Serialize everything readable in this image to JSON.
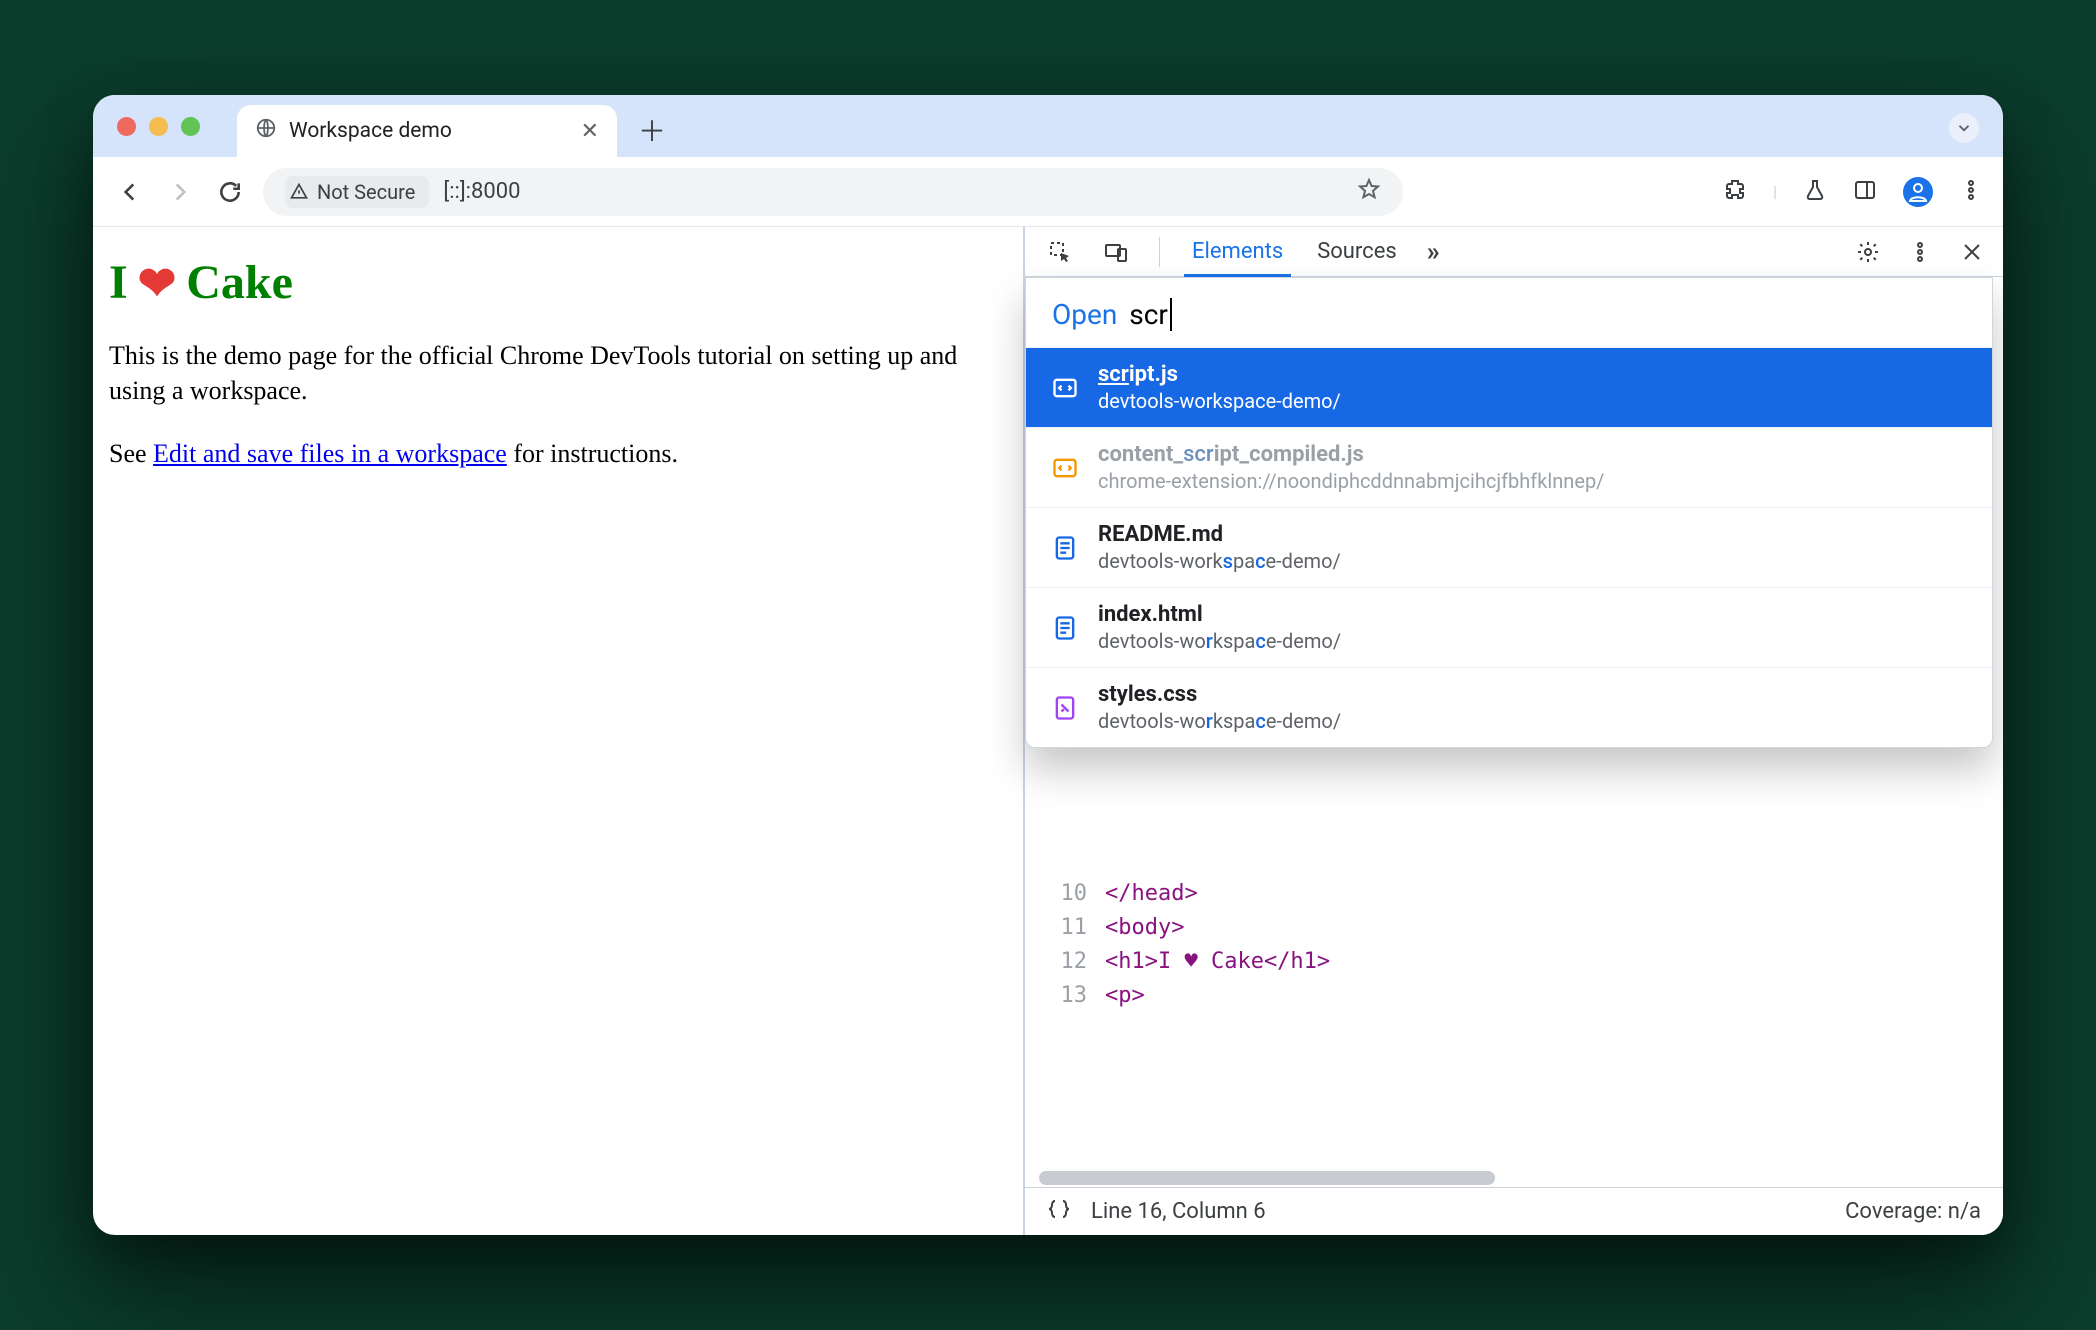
{
  "browser": {
    "tab_title": "Workspace demo",
    "omnibox": {
      "security_label": "Not Secure",
      "url": "[::]:8000"
    }
  },
  "page": {
    "heading_left": "I",
    "heading_right": "Cake",
    "paragraph": "This is the demo page for the official Chrome DevTools tutorial on setting up and using a workspace.",
    "link_pre": "See ",
    "link_text": "Edit and save files in a workspace",
    "link_post": " for instructions."
  },
  "devtools": {
    "tabs": {
      "elements": "Elements",
      "sources": "Sources",
      "overflow": "»"
    },
    "open": {
      "label": "Open",
      "query": "scr",
      "results": [
        {
          "name_pre": "",
          "name_hl": "scr",
          "name_post": "ipt.js",
          "path": "devtools-workspace-demo/",
          "icon": "script",
          "selected": true
        },
        {
          "name_pre": "content_",
          "name_hl": "scr",
          "name_post": "ipt_compiled.js",
          "path": "chrome-extension://noondiphcddnnabmjcihcjfbhfklnnep/",
          "icon": "script-ext",
          "dim": true
        },
        {
          "name_pre": "README.md",
          "name_hl": "",
          "name_post": "",
          "path_pre": "devtools-work",
          "path_hl1": "s",
          "path_mid": "pa",
          "path_hl2": "c",
          "path_post": "e-demo/",
          "icon": "doc"
        },
        {
          "name_pre": "index.html",
          "name_hl": "",
          "name_post": "",
          "path_pre": "devtools-wo",
          "path_hl1": "r",
          "path_mid": "kspa",
          "path_hl2": "c",
          "path_post": "e-demo/",
          "icon": "doc"
        },
        {
          "name_pre": "styles.css",
          "name_hl": "",
          "name_post": "",
          "path_pre": "devtools-wo",
          "path_hl1": "r",
          "path_mid": "kspa",
          "path_hl2": "c",
          "path_post": "e-demo/",
          "icon": "style"
        }
      ]
    },
    "code": {
      "lines": [
        {
          "n": "10",
          "html": "</head>"
        },
        {
          "n": "11",
          "html": "<body>"
        },
        {
          "n": "12",
          "html": "  <h1>I ♥ Cake</h1>"
        },
        {
          "n": "13",
          "html": "    <p>"
        }
      ]
    },
    "status": {
      "cursor": "Line 16, Column 6",
      "coverage": "Coverage: n/a"
    }
  }
}
